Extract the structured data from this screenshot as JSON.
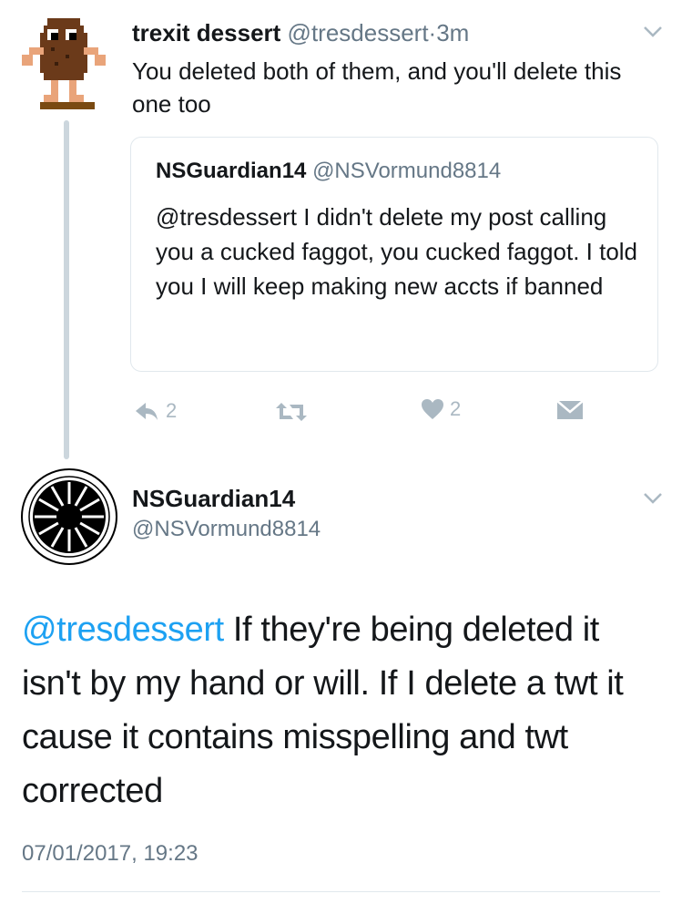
{
  "tweet1": {
    "display_name": "trexit dessert",
    "handle": "@tresdessert",
    "separator": "·",
    "time": "3m",
    "text": "You deleted both of them, and you'll delete this one too",
    "avatar_icon": "pixel-potato-avatar-icon",
    "quote": {
      "display_name": "NSGuardian14",
      "handle": "@NSVormund8814",
      "text": "@tresdessert I didn't delete my post calling you a cucked faggot, you cucked faggot.  I told you I will keep making new accts if banned"
    },
    "actions": {
      "reply_count": "2",
      "like_count": "2"
    }
  },
  "tweet2": {
    "display_name": "NSGuardian14",
    "handle": "@NSVormund8814",
    "avatar_icon": "black-sun-emblem-avatar-icon",
    "mention": "@tresdessert",
    "text": " If they're being deleted it isn't by my hand or will.  If I delete a twt it cause it contains misspelling and twt corrected",
    "timestamp": "07/01/2017, 19:23"
  },
  "colors": {
    "link": "#1da1f2",
    "secondary_text": "#657786",
    "icon_gray": "#aab8c2",
    "border": "#e1e8ed",
    "thread_line": "#ccd6dd"
  }
}
